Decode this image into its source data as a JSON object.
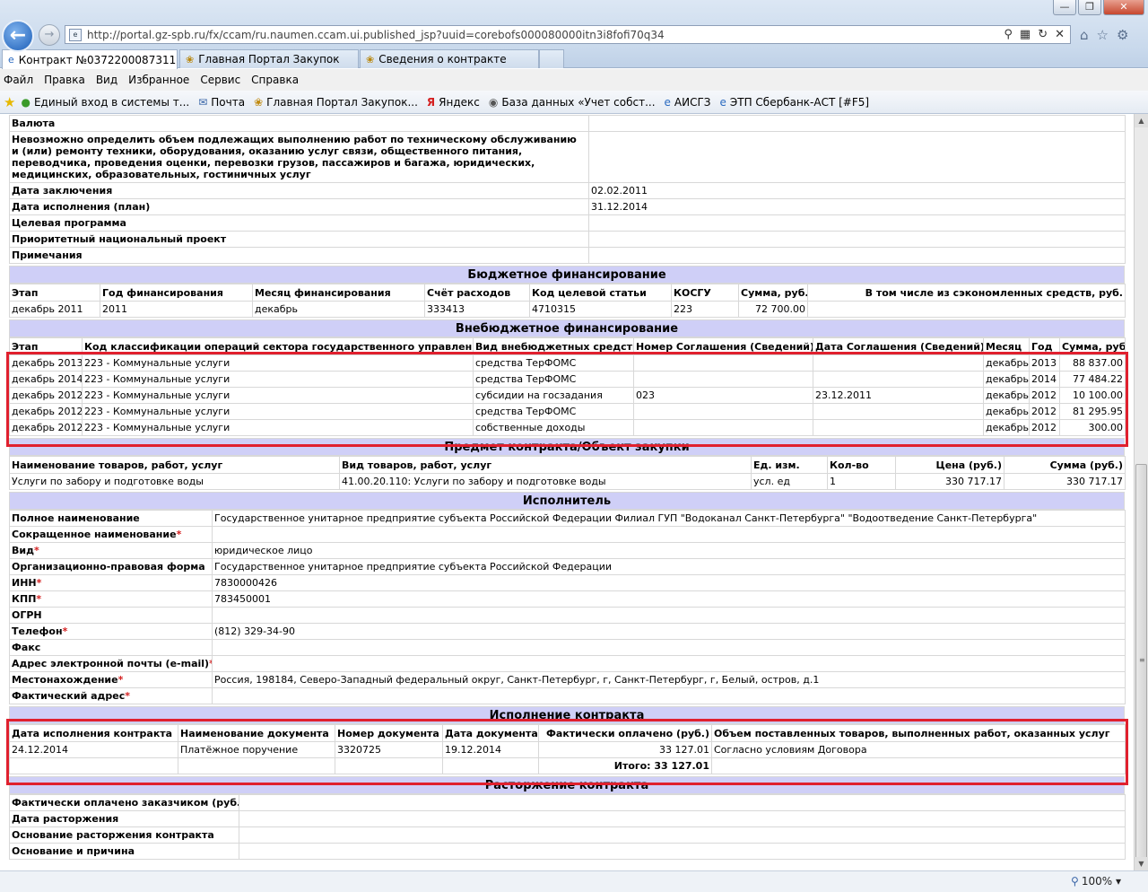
{
  "browser": {
    "url": "http://portal.gz-spb.ru/fx/ccam/ru.naumen.ccam.ui.published_jsp?uuid=corebofs000080000itn3i8fofi70q34",
    "tabs": [
      {
        "label": "Контракт №0372200087311..."
      },
      {
        "label": "Главная Портал Закупок"
      },
      {
        "label": "Сведения о контракте"
      }
    ],
    "menu": [
      "Файл",
      "Правка",
      "Вид",
      "Избранное",
      "Сервис",
      "Справка"
    ],
    "favorites": [
      "Единый вход в системы т...",
      "Почта",
      "Главная Портал Закупок...",
      "Яндекс",
      "База данных «Учет собст...",
      "АИСГЗ",
      "ЭТП Сбербанк-АСТ [#F5]"
    ],
    "zoom": "100%"
  },
  "top_section": {
    "rows": [
      {
        "label": "Валюта",
        "value": ""
      },
      {
        "label": "Невозможно определить объем подлежащих выполнению работ по техническому обслуживанию и (или) ремонту техники, оборудования, оказанию услуг связи, общественного питания, переводчика, проведения оценки, перевозки грузов, пассажиров и багажа, юридических, медицинских, образовательных, гостиничных услуг",
        "value": ""
      },
      {
        "label": "Дата заключения",
        "value": "02.02.2011"
      },
      {
        "label": "Дата исполнения (план)",
        "value": "31.12.2014"
      },
      {
        "label": "Целевая программа",
        "value": ""
      },
      {
        "label": "Приоритетный национальный проект",
        "value": ""
      },
      {
        "label": "Примечания",
        "value": ""
      }
    ]
  },
  "budget": {
    "title": "Бюджетное финансирование",
    "headers": [
      "Этап",
      "Год финансирования",
      "Месяц финансирования",
      "Счёт расходов",
      "Код целевой статьи",
      "КОСГУ",
      "Сумма, руб.",
      "В том числе из сэкономленных средств, руб."
    ],
    "rows": [
      [
        "декабрь 2011",
        "2011",
        "декабрь",
        "333413",
        "4710315",
        "223",
        "72 700.00",
        ""
      ]
    ]
  },
  "extrabudget": {
    "title": "Внебюджетное финансирование",
    "headers": [
      "Этап",
      "Код классификации операций сектора государственного управления",
      "Вид внебюджетных средств",
      "Номер Соглашения (Сведений)",
      "Дата Соглашения (Сведений)",
      "Месяц",
      "Год",
      "Сумма, руб."
    ],
    "rows": [
      [
        "декабрь 2013",
        "223 - Коммунальные услуги",
        "средства ТерФОМС",
        "",
        "",
        "декабрь",
        "2013",
        "88 837.00"
      ],
      [
        "декабрь 2014",
        "223 - Коммунальные услуги",
        "средства ТерФОМС",
        "",
        "",
        "декабрь",
        "2014",
        "77 484.22"
      ],
      [
        "декабрь 2012",
        "223 - Коммунальные услуги",
        "субсидии на госзадания",
        "023",
        "23.12.2011",
        "декабрь",
        "2012",
        "10 100.00"
      ],
      [
        "декабрь 2012",
        "223 - Коммунальные услуги",
        "средства ТерФОМС",
        "",
        "",
        "декабрь",
        "2012",
        "81 295.95"
      ],
      [
        "декабрь 2012",
        "223 - Коммунальные услуги",
        "собственные доходы",
        "",
        "",
        "декабрь",
        "2012",
        "300.00"
      ]
    ]
  },
  "subject": {
    "title": "Предмет контракта/Объект закупки",
    "headers": [
      "Наименование товаров, работ, услуг",
      "Вид товаров, работ, услуг",
      "Ед. изм.",
      "Кол-во",
      "Цена (руб.)",
      "Сумма (руб.)"
    ],
    "rows": [
      [
        "Услуги по забору и подготовке воды",
        "41.00.20.110: Услуги по забору и подготовке воды",
        "усл. ед",
        "1",
        "330 717.17",
        "330 717.17"
      ]
    ]
  },
  "executor": {
    "title": "Исполнитель",
    "rows": [
      {
        "label": "Полное наименование",
        "required": false,
        "value": "Государственное унитарное предприятие субъекта Российской Федерации Филиал ГУП \"Водоканал Санкт-Петербурга\" \"Водоотведение Санкт-Петербурга\""
      },
      {
        "label": "Сокращенное наименование",
        "required": true,
        "value": ""
      },
      {
        "label": "Вид",
        "required": true,
        "value": "юридическое лицо"
      },
      {
        "label": "Организационно-правовая форма",
        "required": false,
        "value": "Государственное унитарное предприятие субъекта Российской Федерации"
      },
      {
        "label": "ИНН",
        "required": true,
        "value": "7830000426"
      },
      {
        "label": "КПП",
        "required": true,
        "value": "783450001"
      },
      {
        "label": "ОГРН",
        "required": false,
        "value": ""
      },
      {
        "label": "Телефон",
        "required": true,
        "value": "(812) 329-34-90"
      },
      {
        "label": "Факс",
        "required": false,
        "value": ""
      },
      {
        "label": "Адрес электронной почты (e-mail)",
        "required": true,
        "value": ""
      },
      {
        "label": "Местонахождение",
        "required": true,
        "value": "Россия, 198184, Северо-Западный федеральный округ, Санкт-Петербург, г, Санкт-Петербург, г, Белый, остров, д.1"
      },
      {
        "label": "Фактический адрес",
        "required": true,
        "value": ""
      }
    ]
  },
  "execution": {
    "title": "Исполнение контракта",
    "headers": [
      "Дата исполнения контракта",
      "Наименование документа",
      "Номер документа",
      "Дата документа",
      "Фактически оплачено (руб.)",
      "Объем поставленных товаров, выполненных работ, оказанных услуг"
    ],
    "rows": [
      [
        "24.12.2014",
        "Платёжное поручение",
        "3320725",
        "19.12.2014",
        "33 127.01",
        "Согласно условиям Договора"
      ]
    ],
    "total": "Итого: 33 127.01"
  },
  "termination": {
    "title": "Расторжение контракта",
    "rows": [
      {
        "label": "Фактически оплачено заказчиком (руб.)",
        "value": ""
      },
      {
        "label": "Дата расторжения",
        "value": ""
      },
      {
        "label": "Основание расторжения контракта",
        "value": ""
      },
      {
        "label": "Основание и причина",
        "value": ""
      }
    ]
  }
}
